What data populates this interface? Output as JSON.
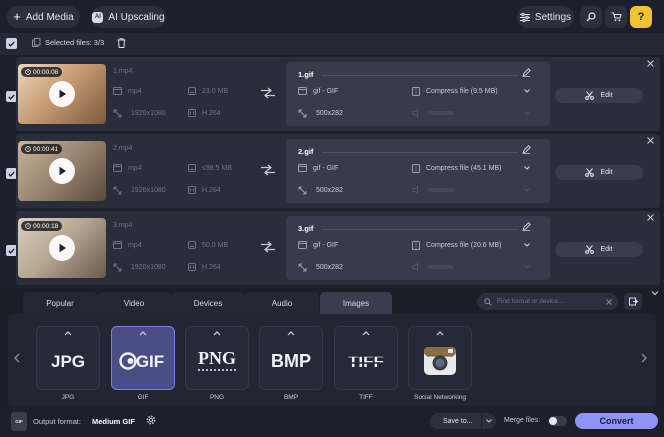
{
  "toolbar": {
    "add_media": "Add Media",
    "ai_upscaling": "AI Upscaling",
    "settings": "Settings",
    "help": "?"
  },
  "selection": {
    "label": "Selected files: 3/3"
  },
  "files": [
    {
      "duration": "00:00:08",
      "source_name": "1.mp4",
      "container": "mp4",
      "size": "23.0 MB",
      "resolution": "1920x1080",
      "codec": "H.264",
      "target_name": "1.gif",
      "target_format": "gif - GIF",
      "compress": "Compress file (9.5 MB)",
      "target_resolution": "500x282",
      "edit": "Edit"
    },
    {
      "duration": "00:00:41",
      "source_name": "2.mp4",
      "container": "mp4",
      "size": "≤98.5 MB",
      "resolution": "1920x1080",
      "codec": "H.264",
      "target_name": "2.gif",
      "target_format": "gif - GIF",
      "compress": "Compress file (45.1 MB)",
      "target_resolution": "500x282",
      "edit": "Edit"
    },
    {
      "duration": "00:00:18",
      "source_name": "3.mp4",
      "container": "mp4",
      "size": "50.0 MB",
      "resolution": "1920x1080",
      "codec": "H.264",
      "target_name": "3.gif",
      "target_format": "gif - GIF",
      "compress": "Compress file (20.6 MB)",
      "target_resolution": "500x282",
      "edit": "Edit"
    }
  ],
  "format_tabs": [
    "Popular",
    "Video",
    "Devices",
    "Audio",
    "Images"
  ],
  "active_tab": "Images",
  "search": {
    "placeholder": "Find format or device..."
  },
  "formats": [
    {
      "label": "JPG",
      "logo": "JPG"
    },
    {
      "label": "GIF",
      "logo": "GIF"
    },
    {
      "label": "PNG",
      "logo": "PNG"
    },
    {
      "label": "BMP",
      "logo": "BMP"
    },
    {
      "label": "TIFF",
      "logo": "TIFF"
    },
    {
      "label": "Social Networking",
      "logo": "camera-icon"
    }
  ],
  "selected_format": "GIF",
  "footer": {
    "output_label": "Output format:",
    "output_value": "Medium GIF",
    "save_to": "Save to...",
    "merge_label": "Merge files:",
    "convert": "Convert"
  },
  "colors": {
    "background": "#1d1f2a",
    "row": "#2a2d3b",
    "target_panel": "#383b4c",
    "accent": "#8f93f7",
    "selected_border": "#7b80e6"
  }
}
